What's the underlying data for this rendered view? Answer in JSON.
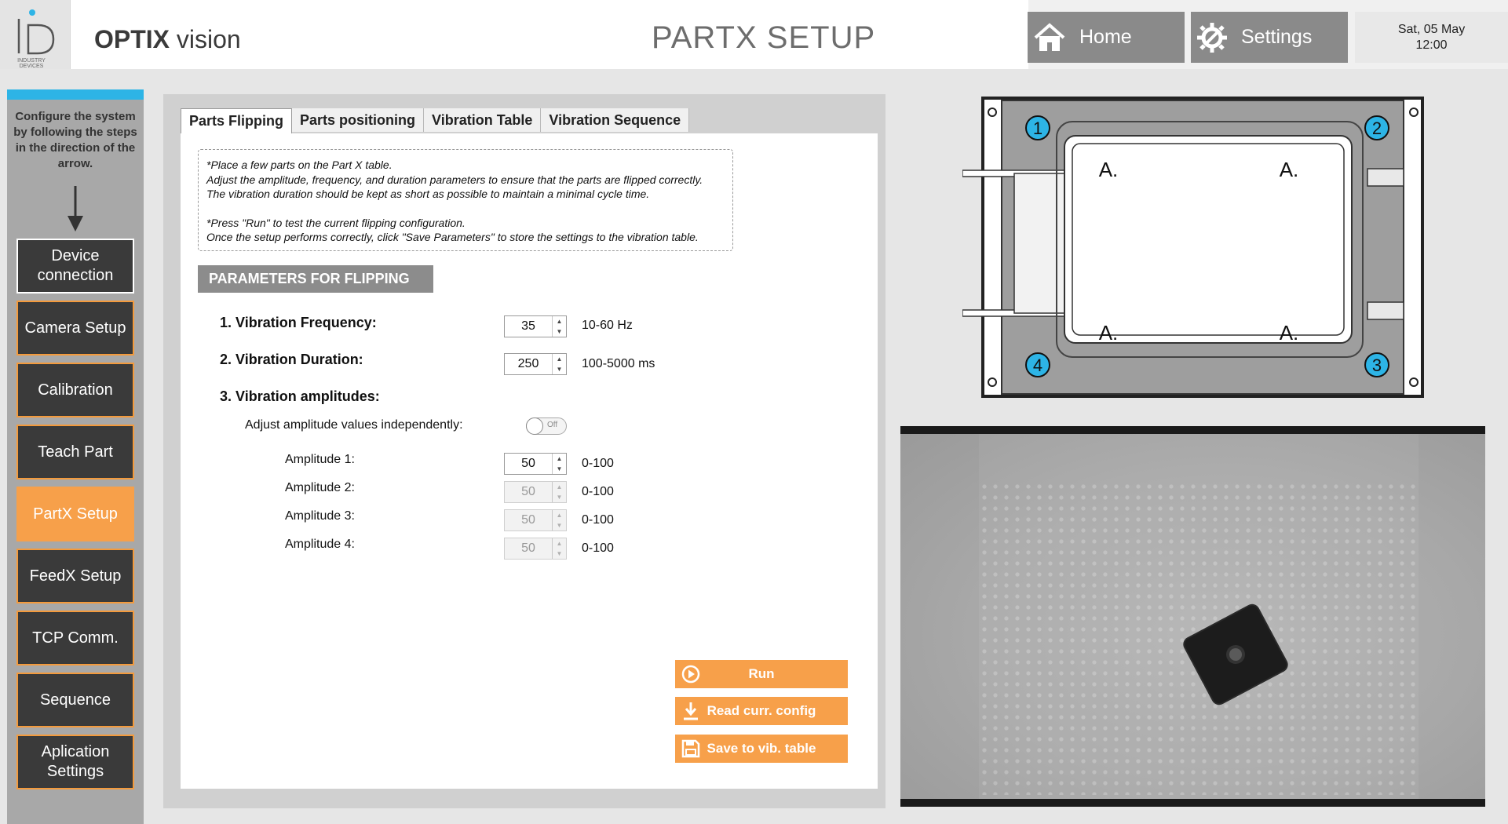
{
  "header": {
    "logo_small_text": "INDUSTRY DEVICES",
    "brand_bold": "OPTIX",
    "brand_light": " vision",
    "title": "PARTX SETUP",
    "home_label": "Home",
    "settings_label": "Settings",
    "date": "Sat, 05 May",
    "time": "12:00"
  },
  "sidebar": {
    "instructions": "Configure the system by following the steps in the direction of the arrow.",
    "items": [
      {
        "label": "Device connection"
      },
      {
        "label": "Camera Setup"
      },
      {
        "label": "Calibration"
      },
      {
        "label": "Teach Part"
      },
      {
        "label": "PartX Setup",
        "active": true
      },
      {
        "label": "FeedX Setup"
      },
      {
        "label": "TCP Comm."
      },
      {
        "label": "Sequence"
      },
      {
        "label": "Aplication Settings"
      }
    ]
  },
  "tabs": [
    "Parts Flipping",
    "Parts positioning",
    "Vibration Table",
    "Vibration Sequence"
  ],
  "note": {
    "line1": "*Place a few parts on the Part X table.",
    "line2": "Adjust the amplitude, frequency, and duration parameters to ensure that the parts are flipped correctly.",
    "line3": "The vibration duration should be kept as short as possible to maintain a minimal cycle time.",
    "line4": "*Press \"Run\" to test the current flipping configuration.",
    "line5": "Once the setup performs correctly, click \"Save Parameters\" to store the settings to the vibration table."
  },
  "params": {
    "section_title": "PARAMETERS FOR FLIPPING",
    "freq_label": "1. Vibration Frequency:",
    "freq_value": "35",
    "freq_range": "10-60 Hz",
    "dur_label": "2. Vibration Duration:",
    "dur_value": "250",
    "dur_range": "100-5000 ms",
    "amp_label": "3. Vibration amplitudes:",
    "independent_label": "Adjust amplitude values independently:",
    "toggle_text": "Off",
    "amplitudes": [
      {
        "label": "Amplitude 1:",
        "value": "50",
        "range": "0-100"
      },
      {
        "label": "Amplitude 2:",
        "value": "50",
        "range": "0-100"
      },
      {
        "label": "Amplitude 3:",
        "value": "50",
        "range": "0-100"
      },
      {
        "label": "Amplitude 4:",
        "value": "50",
        "range": "0-100"
      }
    ]
  },
  "actions": {
    "run": "Run",
    "read": "Read curr. config",
    "save": "Save to vib. table"
  },
  "diagram": {
    "corner_labels": [
      "1",
      "2",
      "3",
      "4"
    ],
    "zone_labels": [
      "A.",
      "A.",
      "A.",
      "A."
    ]
  },
  "colors": {
    "accent": "#f7a04a",
    "header_button": "#8a8a8a",
    "nav_dark": "#3a3a3a",
    "marker_blue": "#2db4e6"
  }
}
